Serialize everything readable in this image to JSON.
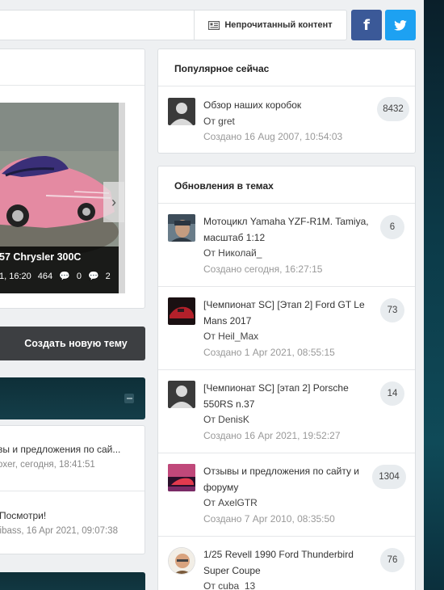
{
  "topbar": {
    "unread_label": "Непрочитанный контент",
    "facebook_glyph": "f"
  },
  "slider": {
    "caption_title": "57 Chrysler 300C",
    "caption_time": "1, 16:20",
    "stat1": "464",
    "stat2": "0",
    "stat3": "2"
  },
  "actions": {
    "new_topic_label": "Создать новую тему"
  },
  "left_list": [
    {
      "title": "вы и предложения по сай...",
      "meta": "oxer, сегодня, 18:41:51"
    },
    {
      "title": "Посмотри!",
      "meta": "libass, 16 Apr 2021, 09:07:38"
    }
  ],
  "popular": {
    "title": "Популярное сейчас",
    "items": [
      {
        "title": "Обзор наших коробок",
        "author": "От gret",
        "date": "Создано 16 Aug 2007, 10:54:03",
        "count": "8432"
      }
    ]
  },
  "updates": {
    "title": "Обновления в темах",
    "items": [
      {
        "title": "Мотоцикл Yamaha YZF-R1M. Tamiya, масштаб 1:12",
        "author": "От Николай_",
        "date": "Создано сегодня, 16:27:15",
        "count": "6"
      },
      {
        "title": "[Чемпионат SC] [Этап 2] Ford GT Le Mans 2017",
        "author": "От Heil_Max",
        "date": "Создано 1 Apr 2021, 08:55:15",
        "count": "73"
      },
      {
        "title": "[Чемпионат SC] [этап 2] Porsche 550RS n.37",
        "author": "От DenisK",
        "date": "Создано 16 Apr 2021, 19:52:27",
        "count": "14"
      },
      {
        "title": "Отзывы и предложения по сайту и форуму",
        "author": "От AxelGTR",
        "date": "Создано 7 Apr 2010, 08:35:50",
        "count": "1304"
      },
      {
        "title": "1/25 Revell 1990 Ford Thunderbird Super Coupe",
        "author": "От cuba_13",
        "date": "",
        "count": "76"
      }
    ]
  },
  "colors": {
    "facebook": "#3b5998",
    "twitter": "#1da1f2",
    "dark_button": "#3d3f42",
    "dark_header": "#0e2f38"
  }
}
